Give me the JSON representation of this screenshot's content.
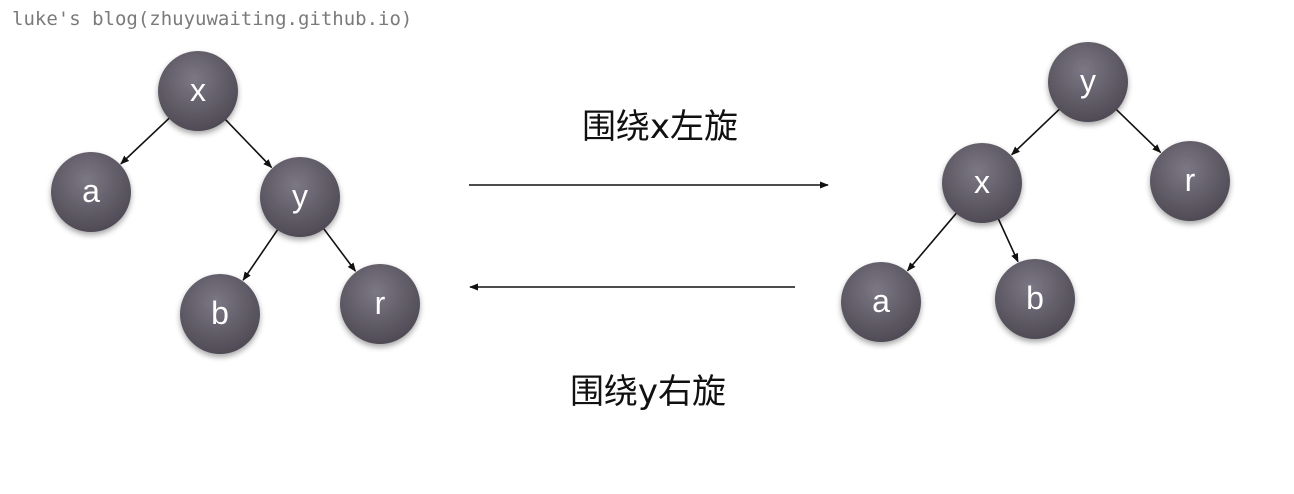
{
  "watermark": "luke's blog(zhuyuwaiting.github.io)",
  "left_tree": {
    "nodes": [
      {
        "id": "x",
        "label": "x"
      },
      {
        "id": "a",
        "label": "a"
      },
      {
        "id": "y",
        "label": "y"
      },
      {
        "id": "b",
        "label": "b"
      },
      {
        "id": "r",
        "label": "r"
      }
    ],
    "edges": [
      [
        "x",
        "a"
      ],
      [
        "x",
        "y"
      ],
      [
        "y",
        "b"
      ],
      [
        "y",
        "r"
      ]
    ]
  },
  "right_tree": {
    "nodes": [
      {
        "id": "y",
        "label": "y"
      },
      {
        "id": "x",
        "label": "x"
      },
      {
        "id": "r",
        "label": "r"
      },
      {
        "id": "a",
        "label": "a"
      },
      {
        "id": "b",
        "label": "b"
      }
    ],
    "edges": [
      [
        "y",
        "x"
      ],
      [
        "y",
        "r"
      ],
      [
        "x",
        "a"
      ],
      [
        "x",
        "b"
      ]
    ]
  },
  "rotations": {
    "left_rotate_label": "围绕x左旋",
    "right_rotate_label": "围绕y右旋"
  },
  "colors": {
    "node_top": "#77727f",
    "node_bottom": "#524e58",
    "edge": "#111111"
  }
}
